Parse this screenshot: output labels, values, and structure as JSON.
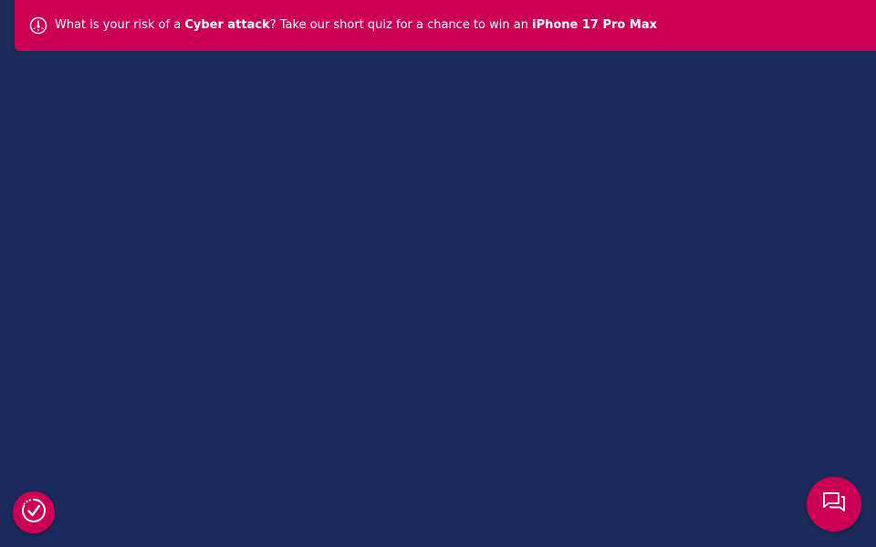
{
  "banner": {
    "text_1": "What is your risk of a ",
    "bold_1": "Cyber attack",
    "text_2": "? Take our short quiz for a chance to win an ",
    "bold_2": "iPhone 17 Pro Max",
    "icon": "gauge-icon"
  },
  "widgets": {
    "left_icon": "accessibility-check-icon",
    "right_icon": "chat-icon"
  },
  "colors": {
    "background": "#1b2b5b",
    "accent": "#cc0055",
    "text": "#ffffff"
  }
}
